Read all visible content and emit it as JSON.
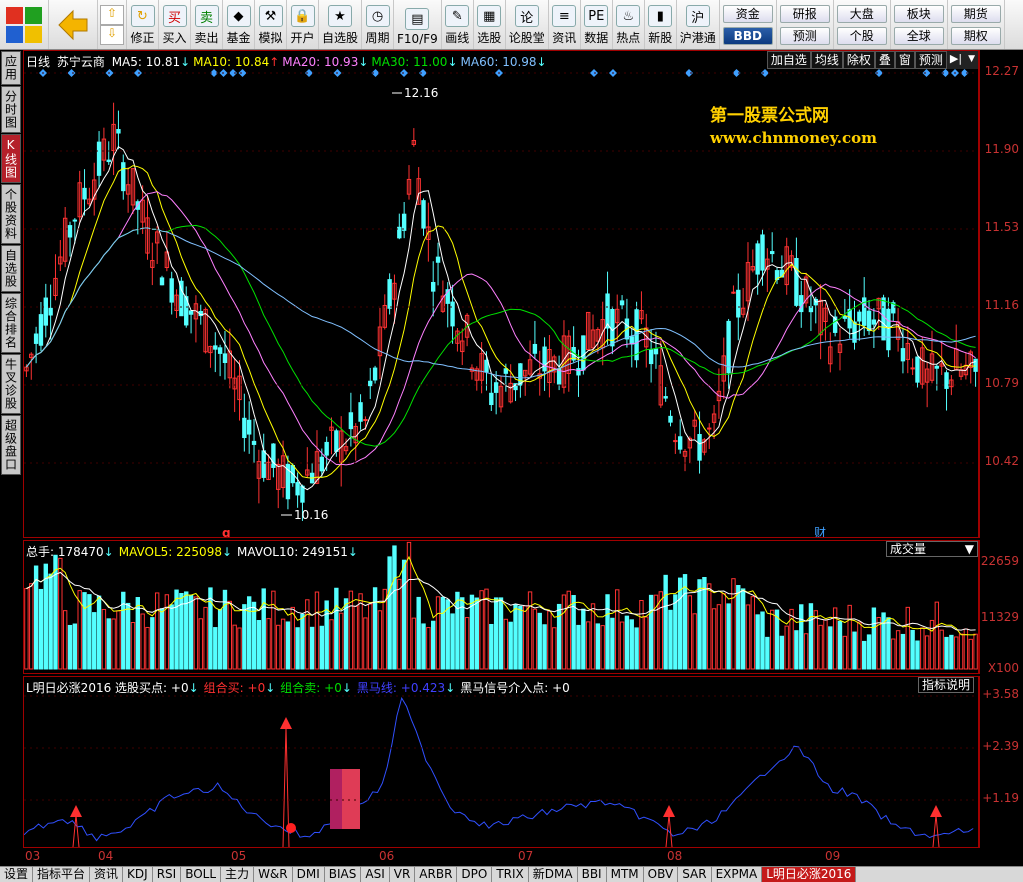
{
  "toolbar": {
    "buttons": [
      {
        "id": "buy",
        "label": "买入",
        "icon": "买"
      },
      {
        "id": "sell",
        "label": "卖出",
        "icon": "卖"
      },
      {
        "id": "fund",
        "label": "基金",
        "icon": "◆"
      },
      {
        "id": "simulate",
        "label": "模拟",
        "icon": "⚒"
      },
      {
        "id": "open",
        "label": "开户",
        "icon": "🔒"
      },
      {
        "id": "watchlist",
        "label": "自选股",
        "icon": "★"
      },
      {
        "id": "period",
        "label": "周期",
        "icon": "◷"
      },
      {
        "id": "f10",
        "label": "F10/F9",
        "icon": "▤"
      },
      {
        "id": "draw",
        "label": "画线",
        "icon": "✎"
      },
      {
        "id": "pick",
        "label": "选股",
        "icon": "▦"
      },
      {
        "id": "forum",
        "label": "论股堂",
        "icon": "论"
      },
      {
        "id": "info",
        "label": "资讯",
        "icon": "≡"
      },
      {
        "id": "data",
        "label": "数据",
        "icon": "PE"
      },
      {
        "id": "hot",
        "label": "热点",
        "icon": "♨"
      },
      {
        "id": "newstock",
        "label": "新股",
        "icon": "▮"
      },
      {
        "id": "hkconnect",
        "label": "沪港通",
        "icon": "沪"
      }
    ],
    "fix_label": "修正",
    "small": {
      "fund_flow": "资金",
      "bbd": "BBD",
      "research": "研报",
      "forecast": "预测",
      "market": "大盘",
      "sector": "板块",
      "stock": "个股",
      "global": "全球",
      "futures": "期货",
      "period_short": "期权"
    }
  },
  "sidebar": [
    "应用",
    "分时图",
    "K线图",
    "个股资料",
    "自选股",
    "综合排名",
    "牛叉诊股",
    "超级盘口"
  ],
  "price": {
    "period_label": "日线",
    "stock_name": "苏宁云商",
    "ma": [
      {
        "label": "MA5: 10.81",
        "arrow": "↓",
        "color": "#ffffff"
      },
      {
        "label": "MA10: 10.84",
        "arrow": "↑",
        "color": "#ffff00"
      },
      {
        "label": "MA20: 10.93",
        "arrow": "↓",
        "color": "#ff80ff"
      },
      {
        "label": "MA30: 11.00",
        "arrow": "↓",
        "color": "#00e000"
      },
      {
        "label": "MA60: 10.98",
        "arrow": "↓",
        "color": "#80c0ff"
      }
    ],
    "right_buttons": [
      "加自选",
      "均线",
      "除权",
      "叠",
      "窗",
      "预测"
    ],
    "watermark_title": "第一股票公式网",
    "watermark_url": "www.chnmoney.com",
    "high_label": "12.16",
    "low_label": "10.16",
    "marker_q": "q",
    "marker_cai": "财",
    "yticks": [
      "12.27",
      "11.90",
      "11.53",
      "11.16",
      "10.79",
      "10.42"
    ]
  },
  "volume": {
    "legend": [
      {
        "label": "总手: 178470",
        "arrow": "↓",
        "color": "#ffffff"
      },
      {
        "label": "MAVOL5: 225098",
        "arrow": "↓",
        "color": "#ffff00"
      },
      {
        "label": "MAVOL10: 249151",
        "arrow": "↓",
        "color": "#ffffff"
      }
    ],
    "selector": "成交量",
    "yticks": [
      "22659",
      "11329",
      "X100"
    ]
  },
  "indicator": {
    "legend": [
      {
        "label": "L明日必涨2016 选股买点: +0",
        "arrow": "↓",
        "color": "#ffffff"
      },
      {
        "label": "组合买: +0",
        "arrow": "↓",
        "color": "#ff3030"
      },
      {
        "label": "组合卖: +0",
        "arrow": "↓",
        "color": "#00e000"
      },
      {
        "label": "黑马线: +0.423",
        "arrow": "↓",
        "color": "#4040ff"
      },
      {
        "label": "黑马信号介入点: +0",
        "arrow": "",
        "color": "#ffffff"
      }
    ],
    "explain_button": "指标说明",
    "yticks": [
      "+3.58",
      "+2.39",
      "+1.19"
    ]
  },
  "xaxis": [
    "03",
    "04",
    "05",
    "06",
    "07",
    "08",
    "09"
  ],
  "bottom_tabs": [
    "设置",
    "指标平台",
    "资讯",
    "KDJ",
    "RSI",
    "BOLL",
    "主力",
    "W&R",
    "DMI",
    "BIAS",
    "ASI",
    "VR",
    "ARBR",
    "DPO",
    "TRIX",
    "新DMA",
    "BBI",
    "MTM",
    "OBV",
    "SAR",
    "EXPMA",
    "L明日必涨2016"
  ],
  "colors": {
    "up": "#ff3232",
    "down": "#54ffff",
    "axis": "#a00000",
    "tick": "#c83232"
  }
}
